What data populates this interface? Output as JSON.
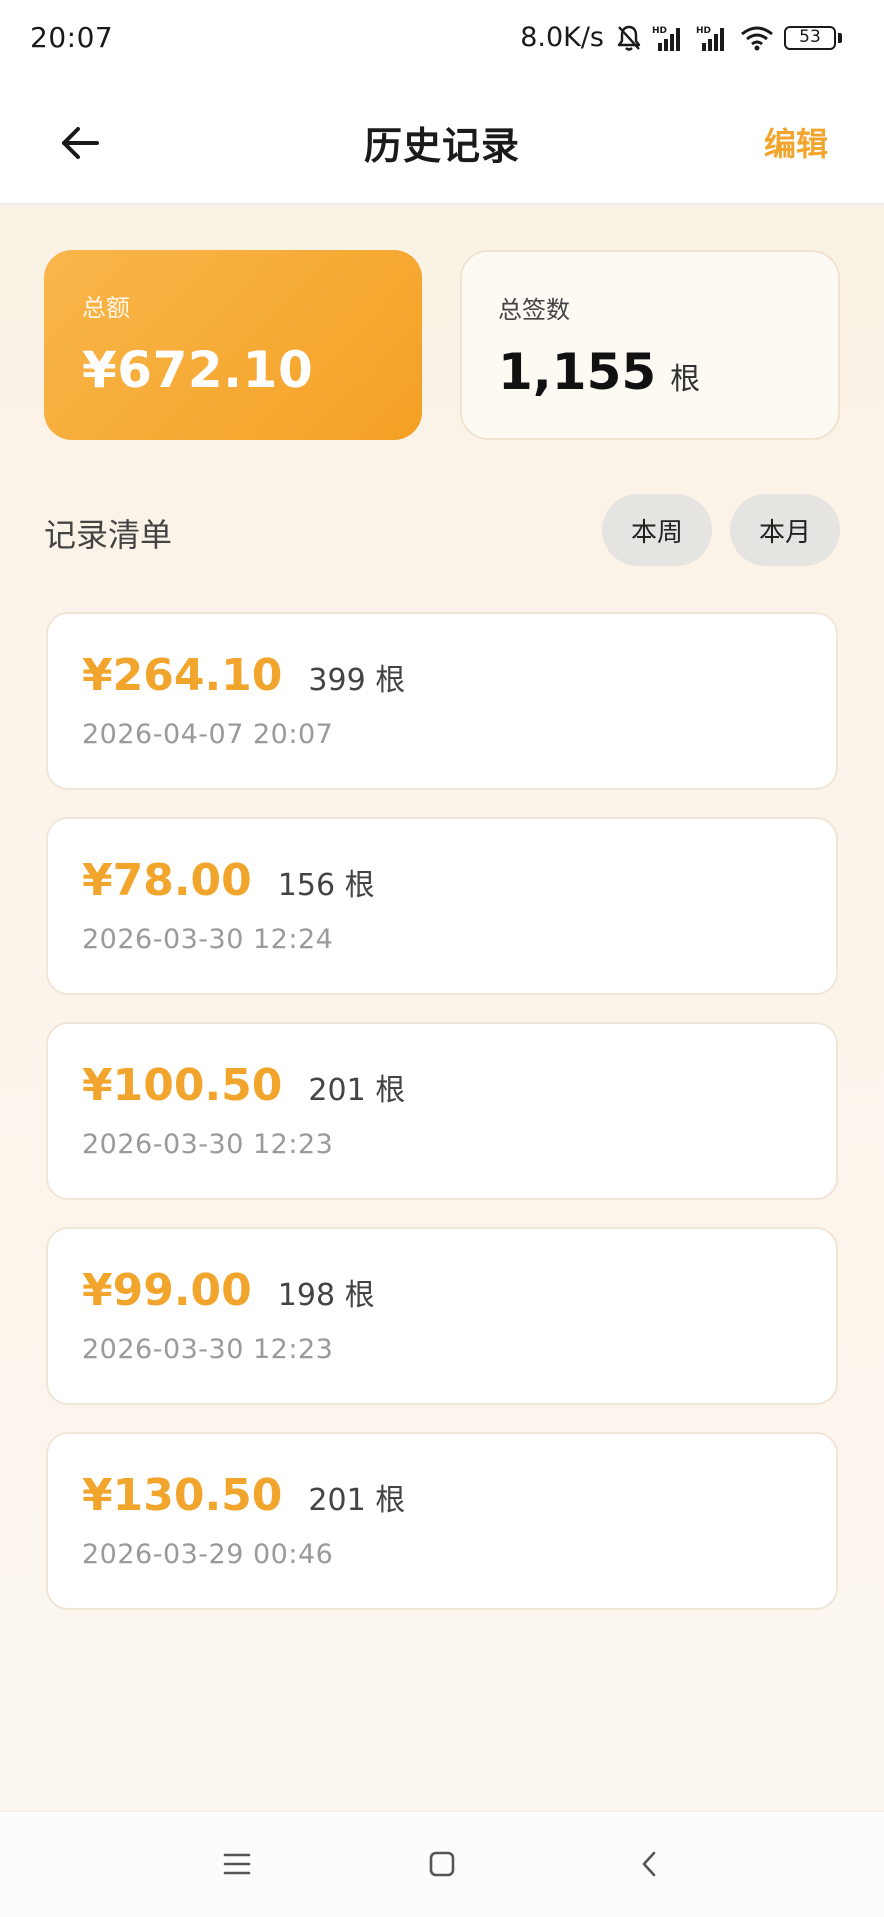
{
  "status_bar": {
    "time": "20:07",
    "net_speed": "8.0K/s",
    "battery": "53",
    "icons": [
      "bell-off-icon",
      "signal-hd-icon",
      "signal-hd-icon",
      "wifi-icon",
      "battery-icon"
    ]
  },
  "header": {
    "back_icon": "arrow-left-icon",
    "title": "历史记录",
    "edit_label": "编辑"
  },
  "summary": {
    "total_label": "总额",
    "total_value": "¥672.10",
    "count_label": "总签数",
    "count_value": "1,155",
    "count_unit": "根"
  },
  "records_section": {
    "title": "记录清单",
    "filters": [
      "本周",
      "本月"
    ]
  },
  "records": [
    {
      "amount": "¥264.10",
      "count": "399 根",
      "time": "2026-04-07 20:07"
    },
    {
      "amount": "¥78.00",
      "count": "156 根",
      "time": "2026-03-30 12:24"
    },
    {
      "amount": "¥100.50",
      "count": "201 根",
      "time": "2026-03-30 12:23"
    },
    {
      "amount": "¥99.00",
      "count": "198 根",
      "time": "2026-03-30 12:23"
    },
    {
      "amount": "¥130.50",
      "count": "201 根",
      "time": "2026-03-29 00:46"
    }
  ],
  "nav_bar": {
    "icons": [
      "menu-icon",
      "home-icon",
      "back-icon"
    ]
  },
  "colors": {
    "accent": "#f2a52c",
    "card_gradient_start": "#f9b64b",
    "card_gradient_end": "#f4a124",
    "background": "#fbf4ea",
    "filter_bg": "#e6e4e0"
  }
}
